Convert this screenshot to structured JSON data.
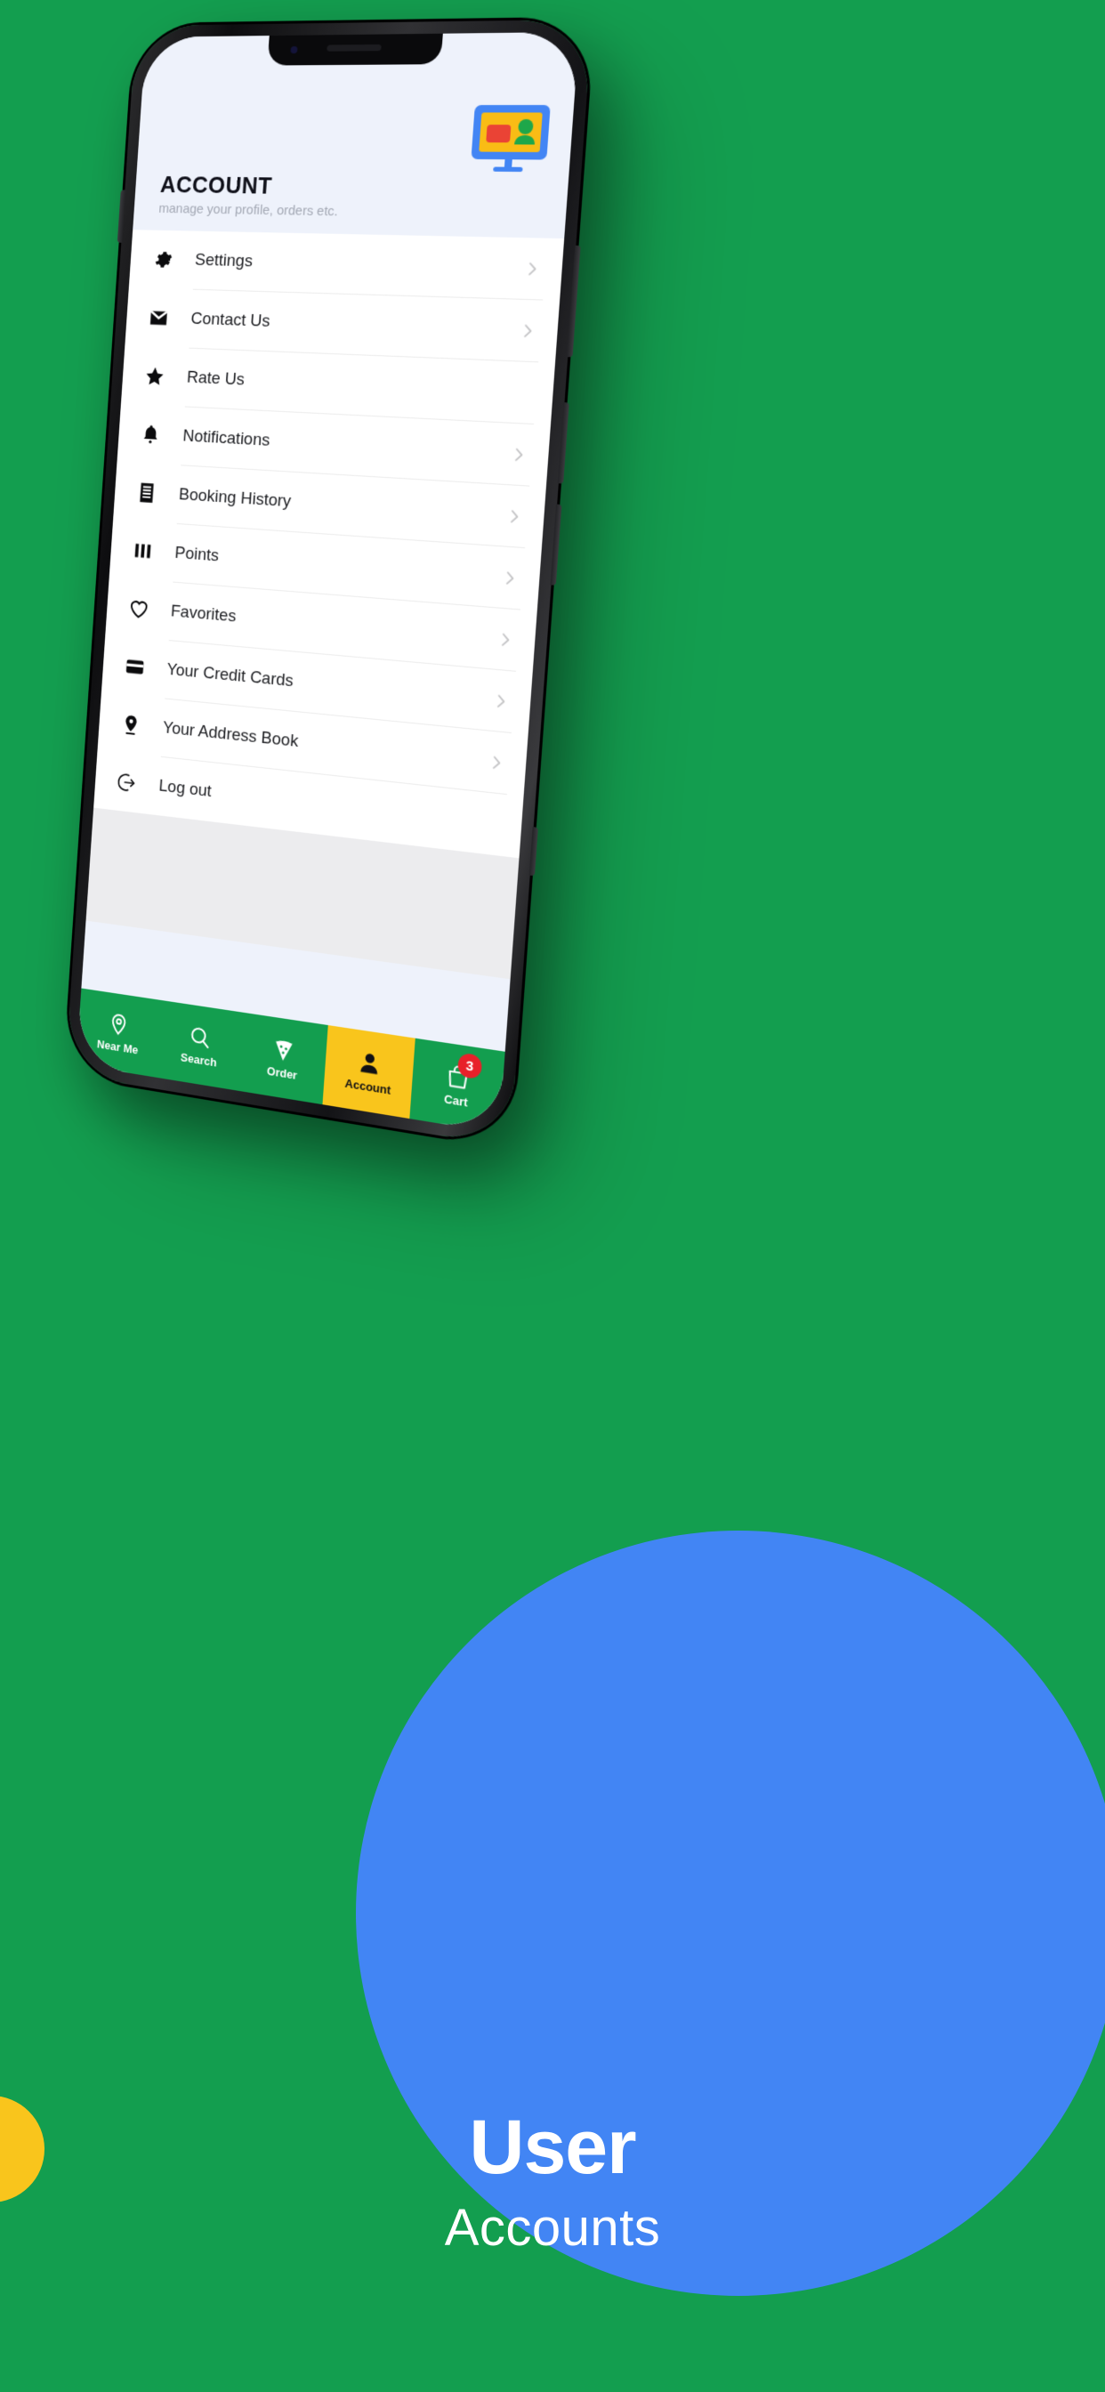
{
  "colors": {
    "background_green": "#139E4F",
    "accent_blue": "#4285F4",
    "accent_yellow": "#F9C51C",
    "badge_red": "#E8202A",
    "header_bg": "#EEF2FB"
  },
  "header": {
    "title": "ACCOUNT",
    "subtitle": "manage your profile, orders etc.",
    "illustration_icon": "monitor-user-card-icon"
  },
  "menu": {
    "items": [
      {
        "label": "Settings",
        "icon": "gear-icon",
        "chevron": true
      },
      {
        "label": "Contact Us",
        "icon": "envelope-icon",
        "chevron": true
      },
      {
        "label": "Rate Us",
        "icon": "star-icon",
        "chevron": false
      },
      {
        "label": "Notifications",
        "icon": "bell-icon",
        "chevron": true
      },
      {
        "label": "Booking History",
        "icon": "receipt-icon",
        "chevron": true
      },
      {
        "label": "Points",
        "icon": "bars-icon",
        "chevron": true
      },
      {
        "label": "Favorites",
        "icon": "heart-icon",
        "chevron": true
      },
      {
        "label": "Your Credit Cards",
        "icon": "credit-card-icon",
        "chevron": true
      },
      {
        "label": "Your Address Book",
        "icon": "map-pin-icon",
        "chevron": true
      },
      {
        "label": "Log out",
        "icon": "logout-icon",
        "chevron": false
      }
    ]
  },
  "bottom_nav": {
    "items": [
      {
        "label": "Near Me",
        "icon": "map-pin-outline-icon",
        "active": false,
        "badge": null
      },
      {
        "label": "Search",
        "icon": "search-icon",
        "active": false,
        "badge": null
      },
      {
        "label": "Order",
        "icon": "pizza-slice-icon",
        "active": false,
        "badge": null
      },
      {
        "label": "Account",
        "icon": "person-icon",
        "active": true,
        "badge": null
      },
      {
        "label": "Cart",
        "icon": "shopping-bag-icon",
        "active": false,
        "badge": "3"
      }
    ]
  },
  "caption": {
    "title": "User",
    "subtitle": "Accounts"
  }
}
